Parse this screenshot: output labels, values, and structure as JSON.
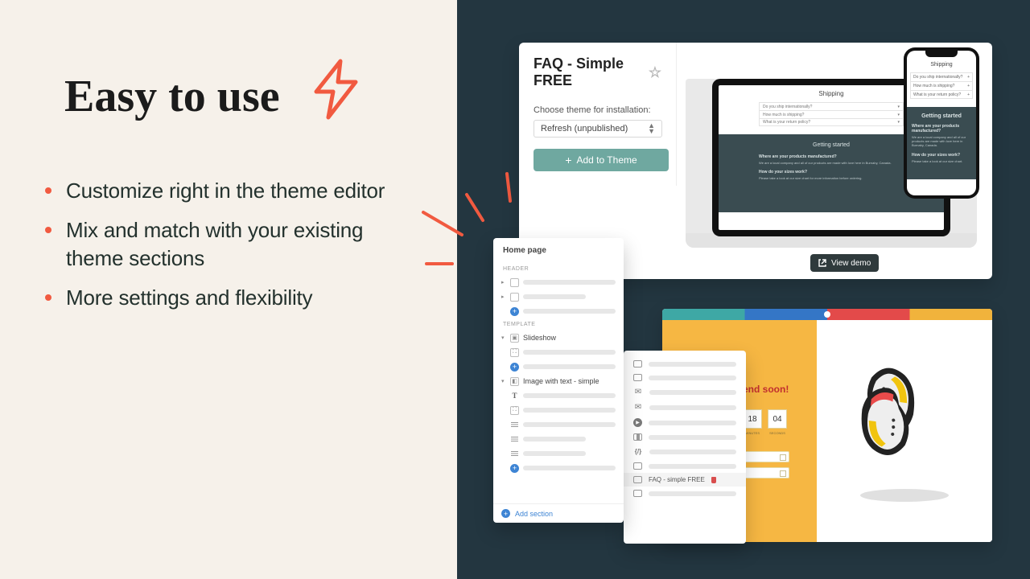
{
  "left": {
    "heading": "Easy to use",
    "bullets": [
      "Customize right in the theme editor",
      "Mix and match with your existing theme sections",
      "More settings and flexibility"
    ]
  },
  "card1": {
    "title": "FAQ - Simple FREE",
    "choose_label": "Choose theme for installation:",
    "select_value": "Refresh (unpublished)",
    "add_btn": "Add to Theme",
    "view_demo": "View demo",
    "laptop": {
      "section_title": "Shipping",
      "rows": [
        "Do you ship internationally?",
        "How much is shipping?",
        "What is your return policy?"
      ],
      "dark_title": "Getting started",
      "q1": "Where are your products manufactured?",
      "a1": "We are a local company and all of our products are made with love here in Burnaby, Canada.",
      "q2": "How do your sizes work?",
      "a2": "Please take a look at our size chart for more information before ordering."
    },
    "phone": {
      "section_title": "Shipping",
      "rows": [
        "Do you ship internationally?",
        "How much is shipping?",
        "What is your return policy?"
      ],
      "dark_title": "Getting started",
      "q1": "Where are your products manufactured?",
      "a1": "We are a local company and all of our products are made with love here in Burnaby, Canada.",
      "q2": "How do your sizes work?",
      "a2": "Please take a look at our size chart."
    }
  },
  "editor1": {
    "title": "Home page",
    "header_label": "HEADER",
    "template_label": "TEMPLATE",
    "slideshow": "Slideshow",
    "image_with_text": "Image with text - simple",
    "add_section": "Add section"
  },
  "editor2": {
    "highlight_text": "FAQ - simple FREE"
  },
  "card2": {
    "headline": "end soon!",
    "timer": [
      "18",
      "04"
    ],
    "timer_labels": [
      "MINUTES",
      "SECONDS"
    ]
  }
}
